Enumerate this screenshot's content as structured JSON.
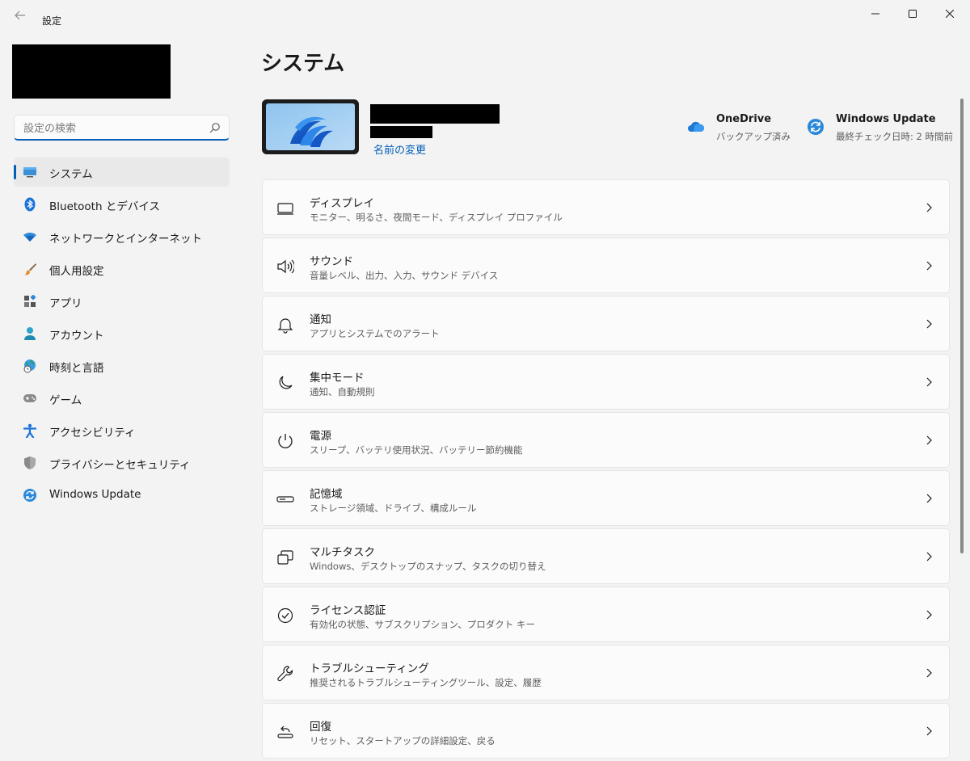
{
  "window": {
    "title": "設定"
  },
  "search": {
    "placeholder": "設定の検索"
  },
  "sidebar": {
    "items": [
      {
        "label": "システム",
        "icon": "monitor-icon",
        "active": true
      },
      {
        "label": "Bluetooth とデバイス",
        "icon": "bluetooth-icon"
      },
      {
        "label": "ネットワークとインターネット",
        "icon": "wifi-icon"
      },
      {
        "label": "個人用設定",
        "icon": "brush-icon"
      },
      {
        "label": "アプリ",
        "icon": "apps-icon"
      },
      {
        "label": "アカウント",
        "icon": "account-icon"
      },
      {
        "label": "時刻と言語",
        "icon": "globe-clock-icon"
      },
      {
        "label": "ゲーム",
        "icon": "gamepad-icon"
      },
      {
        "label": "アクセシビリティ",
        "icon": "accessibility-icon"
      },
      {
        "label": "プライバシーとセキュリティ",
        "icon": "shield-icon"
      },
      {
        "label": "Windows Update",
        "icon": "sync-icon"
      }
    ]
  },
  "main": {
    "title": "システム",
    "device": {
      "rename_label": "名前の変更"
    },
    "status": [
      {
        "title": "OneDrive",
        "subtitle": "バックアップ済み",
        "icon": "cloud-icon"
      },
      {
        "title": "Windows Update",
        "subtitle": "最終チェック日時: 2 時間前",
        "icon": "sync-icon"
      }
    ],
    "cards": [
      {
        "title": "ディスプレイ",
        "subtitle": "モニター、明るさ、夜間モード、ディスプレイ プロファイル",
        "icon": "display-icon"
      },
      {
        "title": "サウンド",
        "subtitle": "音量レベル、出力、入力、サウンド デバイス",
        "icon": "speaker-icon"
      },
      {
        "title": "通知",
        "subtitle": "アプリとシステムでのアラート",
        "icon": "bell-icon"
      },
      {
        "title": "集中モード",
        "subtitle": "通知、自動規則",
        "icon": "moon-icon"
      },
      {
        "title": "電源",
        "subtitle": "スリープ、バッテリ使用状況、バッテリー節約機能",
        "icon": "power-icon"
      },
      {
        "title": "記憶域",
        "subtitle": "ストレージ領域、ドライブ、構成ルール",
        "icon": "storage-icon"
      },
      {
        "title": "マルチタスク",
        "subtitle": "Windows、デスクトップのスナップ、タスクの切り替え",
        "icon": "multitask-icon"
      },
      {
        "title": "ライセンス認証",
        "subtitle": "有効化の状態、サブスクリプション、プロダクト キー",
        "icon": "check-circle-icon"
      },
      {
        "title": "トラブルシューティング",
        "subtitle": "推奨されるトラブルシューティングツール、設定、履歴",
        "icon": "wrench-icon"
      },
      {
        "title": "回復",
        "subtitle": "リセット、スタートアップの詳細設定、戻る",
        "icon": "recovery-icon"
      }
    ]
  },
  "colors": {
    "accent": "#005fb8",
    "background": "#f3f3f3",
    "card": "#fbfbfb"
  }
}
